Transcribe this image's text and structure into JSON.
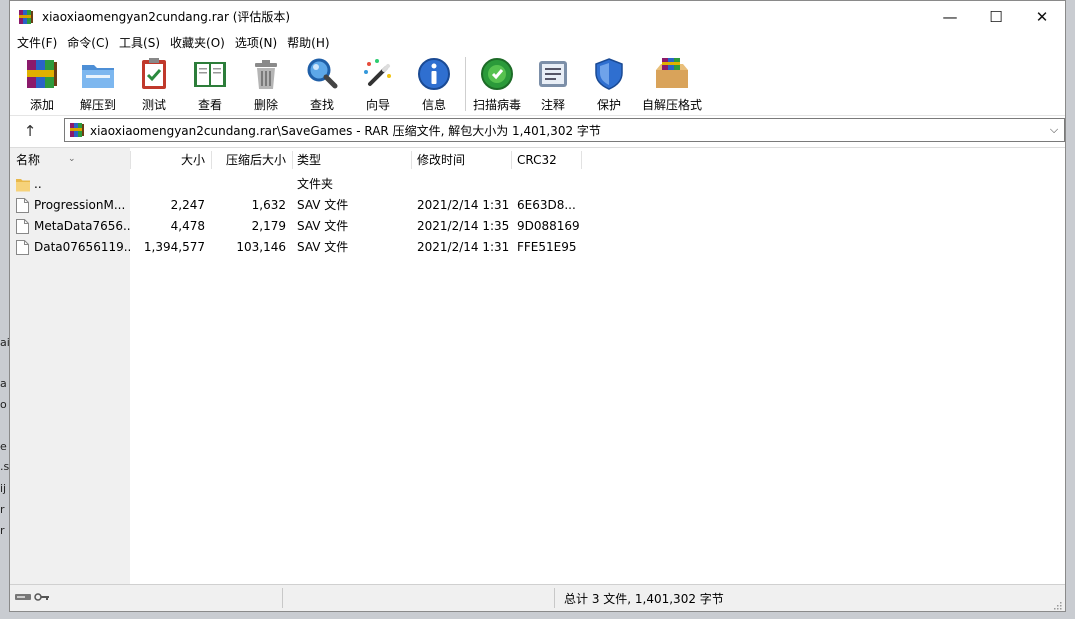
{
  "window": {
    "title": "xiaoxiaomengyan2cundang.rar (评估版本)",
    "minimize": "—",
    "maximize": "☐",
    "close": "✕"
  },
  "menu": [
    "文件(F)",
    "命令(C)",
    "工具(S)",
    "收藏夹(O)",
    "选项(N)",
    "帮助(H)"
  ],
  "toolbar": [
    {
      "label": "添加",
      "icon": "winrar-add-icon"
    },
    {
      "label": "解压到",
      "icon": "folder-extract-icon"
    },
    {
      "label": "测试",
      "icon": "clipboard-test-icon"
    },
    {
      "label": "查看",
      "icon": "book-view-icon"
    },
    {
      "label": "删除",
      "icon": "trash-icon"
    },
    {
      "label": "查找",
      "icon": "magnifier-icon"
    },
    {
      "label": "向导",
      "icon": "wand-icon"
    },
    {
      "label": "信息",
      "icon": "info-icon"
    },
    {
      "label": "扫描病毒",
      "icon": "virus-scan-icon"
    },
    {
      "label": "注释",
      "icon": "comment-icon"
    },
    {
      "label": "保护",
      "icon": "shield-icon"
    },
    {
      "label": "自解压格式",
      "icon": "sfx-box-icon"
    }
  ],
  "address": {
    "up": "↑",
    "path": "xiaoxiaomengyan2cundang.rar\\SaveGames - RAR 压缩文件, 解包大小为 1,401,302 字节",
    "dropdown": "⌵"
  },
  "columns": {
    "name": "名称",
    "size": "大小",
    "packed": "压缩后大小",
    "type": "类型",
    "modified": "修改时间",
    "crc": "CRC32"
  },
  "files": [
    {
      "name": "..",
      "size": "",
      "packed": "",
      "type": "文件夹",
      "modified": "",
      "crc": "",
      "kind": "folder"
    },
    {
      "name": "ProgressionM...",
      "size": "2,247",
      "packed": "1,632",
      "type": "SAV 文件",
      "modified": "2021/2/14 1:31",
      "crc": "6E63D8...",
      "kind": "file"
    },
    {
      "name": "MetaData7656...",
      "size": "4,478",
      "packed": "2,179",
      "type": "SAV 文件",
      "modified": "2021/2/14 1:35",
      "crc": "9D088169",
      "kind": "file"
    },
    {
      "name": "Data07656119...",
      "size": "1,394,577",
      "packed": "103,146",
      "type": "SAV 文件",
      "modified": "2021/2/14 1:31",
      "crc": "FFE51E95",
      "kind": "file"
    }
  ],
  "status": {
    "total": "总计 3 文件, 1,401,302 字节"
  },
  "background_fragments": [
    "ai",
    "a",
    "o",
    "e",
    ".s",
    "ij",
    "r",
    "r"
  ]
}
